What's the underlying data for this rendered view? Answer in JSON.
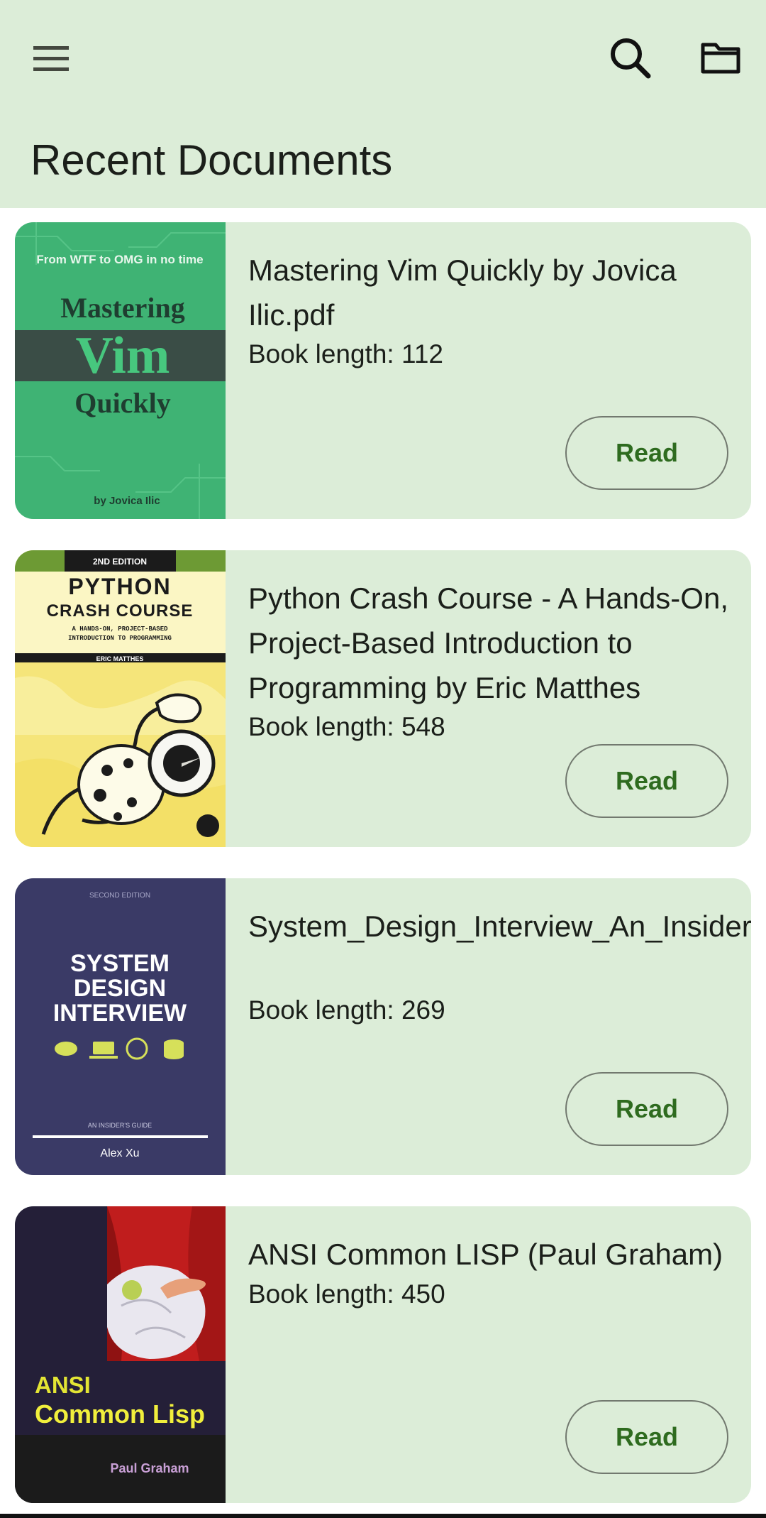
{
  "header": {
    "title": "Recent Documents",
    "menu_icon": "menu-icon",
    "search_icon": "search-icon",
    "folder_icon": "folder-icon"
  },
  "colors": {
    "app_bar_bg": "#dcedd8",
    "card_bg": "#dcedd8",
    "accent": "#2e6b1f",
    "outline": "#72796f"
  },
  "documents": [
    {
      "title": "Mastering Vim Quickly by Jovica Ilic.pdf",
      "length_label": "Book length: 112",
      "button_label": "Read",
      "cover": {
        "tagline": "From WTF to OMG in no time",
        "line1": "Mastering",
        "line2": "Vim",
        "line3": "Quickly",
        "author": "by Jovica Ilic"
      }
    },
    {
      "title": "Python Crash Course - A Hands-On, Project-Based Introduction to Programming by Eric Matthes",
      "length_label": "Book length: 548",
      "button_label": "Read",
      "cover": {
        "edition": "2ND EDITION",
        "line1": "PYTHON",
        "line2": "CRASH COURSE",
        "subtitle1": "A HANDS-ON, PROJECT-BASED",
        "subtitle2": "INTRODUCTION TO PROGRAMMING",
        "author": "ERIC MATTHES"
      }
    },
    {
      "title": "System_Design_Interview_An_Insider’s_Guide_Alex_.pdf",
      "length_label": "Book length: 269",
      "button_label": "Read",
      "cover": {
        "edition": "SECOND EDITION",
        "line1": "SYSTEM",
        "line2": "DESIGN",
        "line3": "INTERVIEW",
        "subtitle": "AN INSIDER'S GUIDE",
        "author": "Alex Xu"
      }
    },
    {
      "title": "ANSI Common LISP (Paul Graham)",
      "length_label": "Book length: 450",
      "button_label": "Read",
      "cover": {
        "line1": "ANSI",
        "line2": "Common Lisp",
        "author": "Paul Graham"
      }
    }
  ]
}
